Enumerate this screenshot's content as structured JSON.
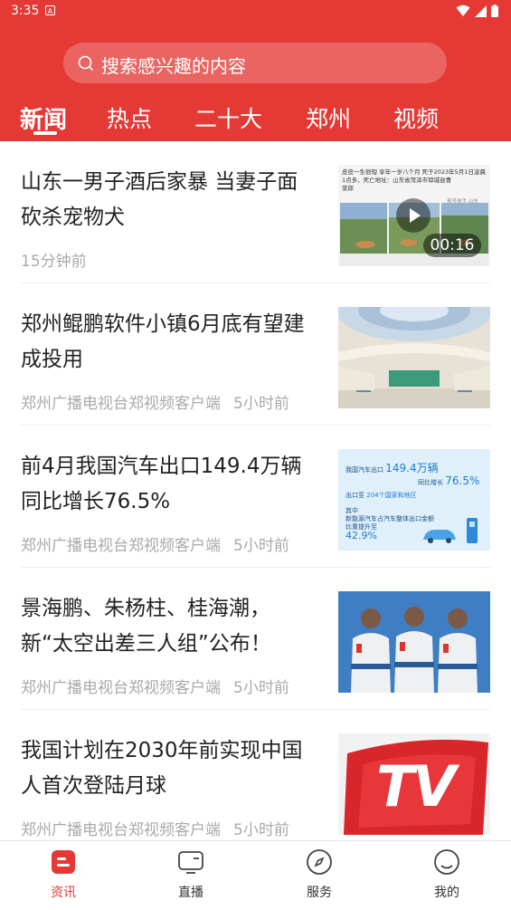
{
  "status_bar": {
    "time": "3:35",
    "notification_badge": "A"
  },
  "search": {
    "placeholder": "搜索感兴趣的内容"
  },
  "tabs": [
    {
      "label": "新闻",
      "active": true
    },
    {
      "label": "热点",
      "active": false
    },
    {
      "label": "二十大",
      "active": false
    },
    {
      "label": "郑州",
      "active": false
    },
    {
      "label": "视频",
      "active": false
    }
  ],
  "news": [
    {
      "title": "山东一男子酒后家暴 当妻子面砍杀宠物犬",
      "source": "",
      "age": "15分钟前",
      "video_duration": "00:16",
      "thumb_caption_line1": "皮皮一生很短 享年一岁八个月 死于2023年5月1日凌晨1点多，死亡地址：山东省菏泽市郓城县曹",
      "thumb_caption_line2": "菜郎",
      "thumb_watermark": "来号快手 山东"
    },
    {
      "title": "郑州鲲鹏软件小镇6月底有望建成投用",
      "source": "郑州广播电视台郑视频客户端",
      "age": "5小时前"
    },
    {
      "title": "前4月我国汽车出口149.4万辆同比增长76.5%",
      "source": "郑州广播电视台郑视频客户端",
      "age": "5小时前",
      "infographic": {
        "line1_label": "我国汽车出口",
        "line1_value": "149.4万辆",
        "line2_label": "同比增长",
        "line2_value": "76.5%",
        "line3_label": "出口至",
        "line3_value": "204个国家和地区",
        "line4": "其中",
        "line5": "新能源汽车占汽车整体出口金额",
        "line6": "比重提升至",
        "line7_value": "42.9%"
      }
    },
    {
      "title": "景海鹏、朱杨柱、桂海潮，新“太空出差三人组”公布！",
      "source": "郑州广播电视台郑视频客户端",
      "age": "5小时前"
    },
    {
      "title": "我国计划在2030年前实现中国人首次登陆月球",
      "source": "郑州广播电视台郑视频客户端",
      "age": "5小时前",
      "logo_text": "TV"
    }
  ],
  "bottom_nav": [
    {
      "label": "资讯",
      "icon": "news-icon",
      "active": true
    },
    {
      "label": "直播",
      "icon": "tv-icon",
      "active": false
    },
    {
      "label": "服务",
      "icon": "compass-icon",
      "active": false
    },
    {
      "label": "我的",
      "icon": "profile-icon",
      "active": false
    }
  ],
  "colors": {
    "brand_red": "#e53935",
    "meta_gray": "#aaaaaa",
    "title_text": "#222222"
  }
}
